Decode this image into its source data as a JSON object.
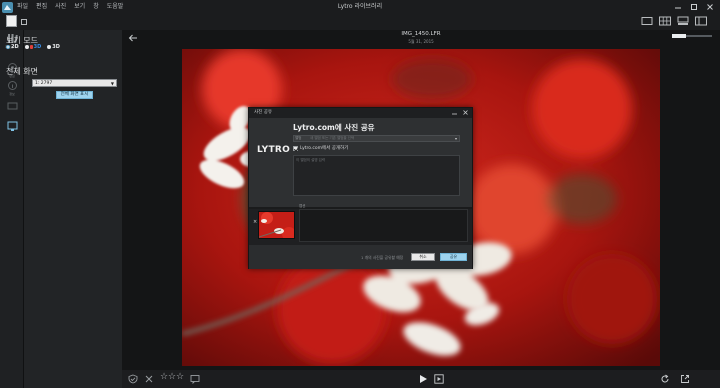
{
  "app": {
    "window_title": "Lytro 라이브러리",
    "menu": [
      "파일",
      "편집",
      "사진",
      "보기",
      "창",
      "도움말"
    ]
  },
  "left_panel": {
    "view_mode_title": "보기 모드",
    "modes": [
      {
        "label": "2D",
        "color": "#e8eaec"
      },
      {
        "label": "3D",
        "colors": [
          "#e0403a",
          "#3a8be0"
        ]
      },
      {
        "label": "3D",
        "colors": [
          "#e8eaec",
          "#e8eaec"
        ]
      }
    ],
    "fullscreen_title": "전체 화면",
    "display_select_value": "1: 2797",
    "fullscreen_button": "전체 화면 표시"
  },
  "icon_strip": [
    {
      "icon": "library-icon",
      "label": "라이브러리"
    },
    {
      "icon": "edit-icon",
      "label": "편집"
    },
    {
      "icon": "info-icon",
      "label": "정보"
    },
    {
      "icon": "film-icon",
      "label": ""
    },
    {
      "icon": "display-icon",
      "label": ""
    }
  ],
  "photo": {
    "file_name": "IMG_1450.LFR",
    "date": "5월 31, 2015"
  },
  "dialog": {
    "title": "사진 공유",
    "logo": "LYTRO",
    "heading": "Lytro.com에 사진 공유",
    "album_prefix": "앨범",
    "album_placeholder": "새 앨범 또는 기존 앨범을 선택",
    "public_label": "Lytro.com에서 공개하기",
    "description_placeholder": "이 앨범의 설명 입력",
    "caption_label": "캡션",
    "share_count": "1 개의 사진을 공유할 예정",
    "cancel_label": "취소",
    "share_label": "공유",
    "remove_label": "×"
  },
  "colors": {
    "accent": "#9ed3ee",
    "background": "#121314",
    "panel": "#222426"
  }
}
